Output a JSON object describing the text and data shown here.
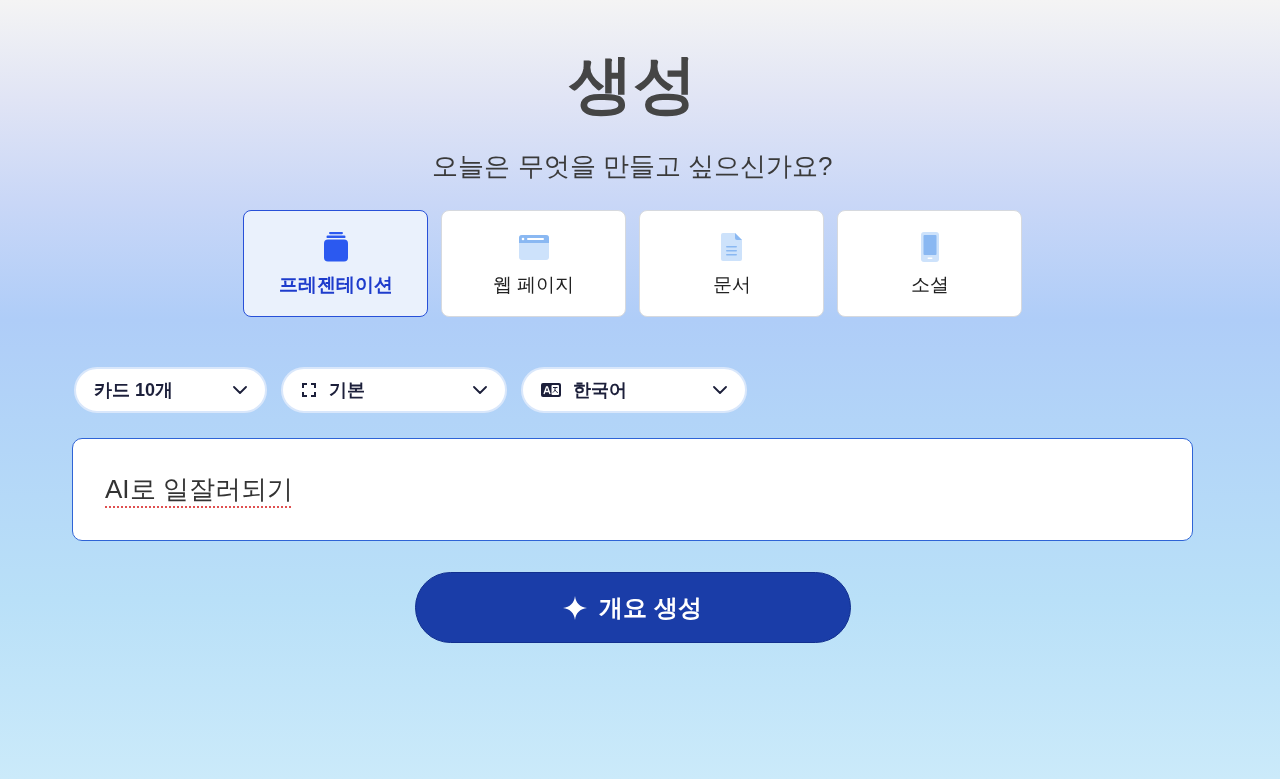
{
  "header": {
    "title": "생성",
    "subtitle": "오늘은 무엇을 만들고 싶으신가요?"
  },
  "types": [
    {
      "label": "프레젠테이션",
      "kind": "presentation",
      "selected": true
    },
    {
      "label": "웹 페이지",
      "kind": "webpage",
      "selected": false
    },
    {
      "label": "문서",
      "kind": "document",
      "selected": false
    },
    {
      "label": "소셜",
      "kind": "social",
      "selected": false
    }
  ],
  "options": [
    {
      "label": "카드 10개",
      "kind": "count"
    },
    {
      "label": "기본",
      "kind": "frame"
    },
    {
      "label": "한국어",
      "kind": "language"
    }
  ],
  "prompt": {
    "value": "AI로 일잘러되기",
    "focused": true
  },
  "generate_button": {
    "label": "개요 생성"
  }
}
